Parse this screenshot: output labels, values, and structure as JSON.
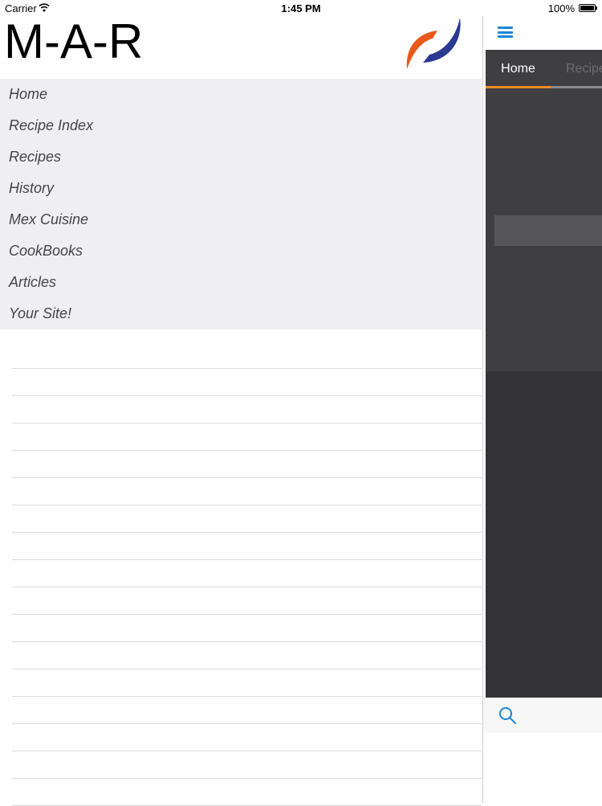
{
  "status_bar": {
    "carrier": "Carrier",
    "time": "1:45 PM",
    "battery": "100%"
  },
  "drawer": {
    "title": "M-A-R",
    "logo_colors": {
      "orange": "#e8591a",
      "blue": "#2b3990"
    },
    "menu": [
      {
        "label": "Home"
      },
      {
        "label": "Recipe Index"
      },
      {
        "label": "Recipes"
      },
      {
        "label": "History"
      },
      {
        "label": "Mex Cuisine"
      },
      {
        "label": "CookBooks"
      },
      {
        "label": "Articles"
      },
      {
        "label": "Your Site!"
      }
    ]
  },
  "main": {
    "menu_icon": "hamburger-icon",
    "tabs": [
      {
        "label": "Home",
        "active": true
      },
      {
        "label": "Recipes",
        "active": false
      }
    ],
    "accent_color": "#f08a24",
    "toolbar": {
      "search_icon": "search-icon"
    }
  }
}
